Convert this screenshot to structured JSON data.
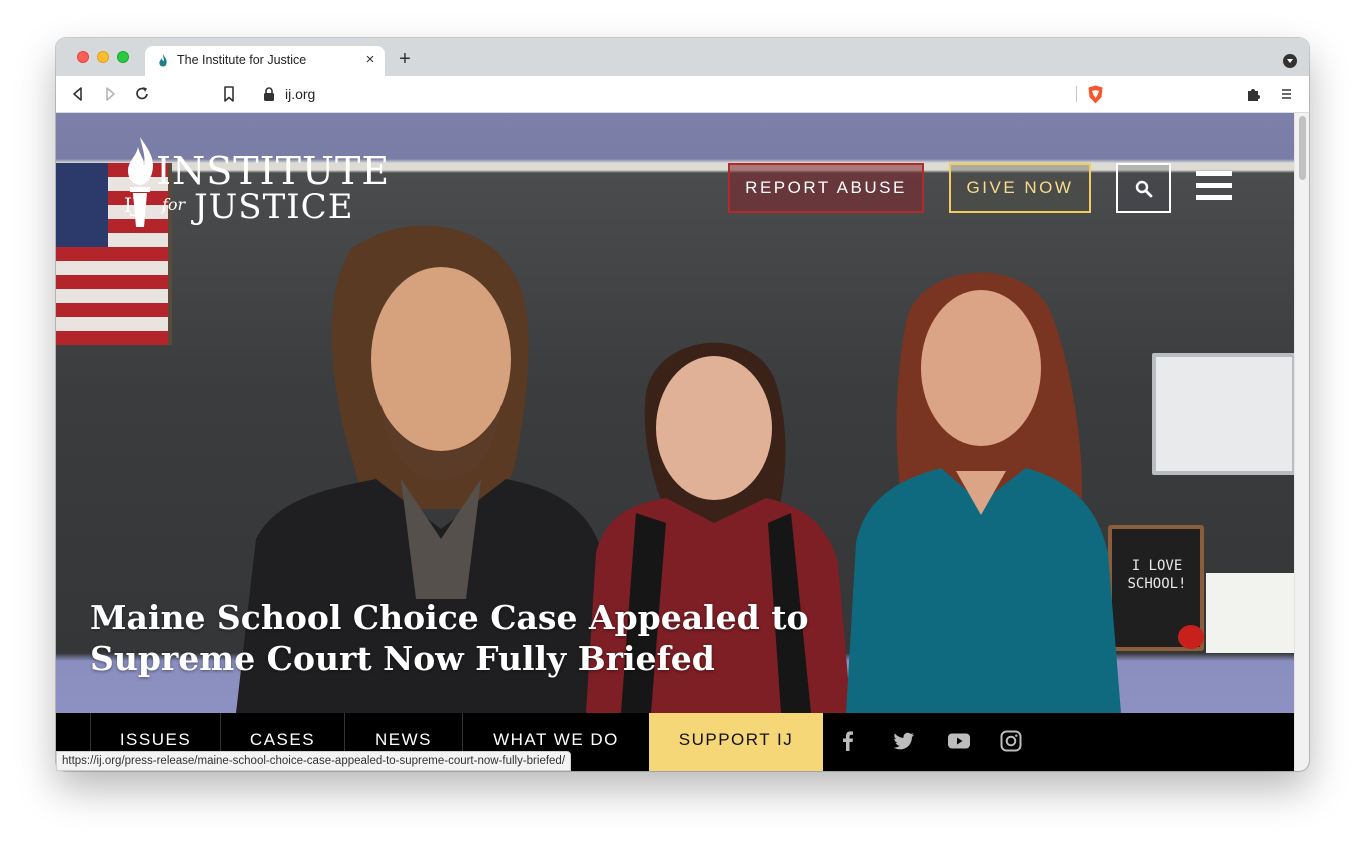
{
  "browser": {
    "tab_title": "The Institute for Justice",
    "new_tab_label": "+",
    "close_label": "×",
    "url": "ij.org",
    "status_url": "https://ij.org/press-release/maine-school-choice-case-appealed-to-supreme-court-now-fully-briefed/"
  },
  "site": {
    "logo": {
      "line1": "INSTITUTE",
      "for": "for",
      "line2": "JUSTICE",
      "ij": "IJ"
    },
    "header": {
      "report_abuse": "REPORT ABUSE",
      "give_now": "GIVE NOW"
    },
    "hero": {
      "headline": "Maine School Choice Case Appealed to Supreme Court Now Fully Briefed",
      "sign_text": "I LOVE SCHOOL!"
    },
    "nav": {
      "items": [
        "ISSUES",
        "CASES",
        "NEWS",
        "WHAT WE DO"
      ],
      "support": "SUPPORT IJ"
    },
    "social_icons": [
      "facebook-icon",
      "twitter-icon",
      "youtube-icon",
      "instagram-icon"
    ]
  },
  "colors": {
    "report_border": "#b22a2a",
    "give_border": "#f2cd5b",
    "support_bg": "#f6d777",
    "nav_bg": "#000000"
  }
}
